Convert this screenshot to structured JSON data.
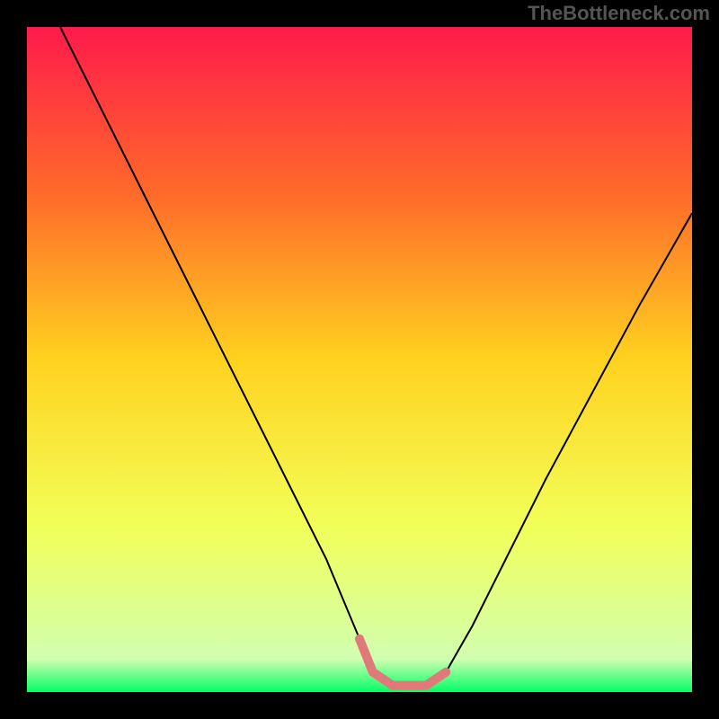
{
  "watermark": "TheBottleneck.com",
  "chart_data": {
    "type": "line",
    "title": "",
    "xlabel": "",
    "ylabel": "",
    "xlim": [
      0,
      100
    ],
    "ylim": [
      0,
      100
    ],
    "gradient_stops": [
      {
        "offset": 0,
        "color": "#ff1a4b"
      },
      {
        "offset": 25,
        "color": "#ff6a2a"
      },
      {
        "offset": 50,
        "color": "#ffd21f"
      },
      {
        "offset": 75,
        "color": "#f2ff59"
      },
      {
        "offset": 95,
        "color": "#d2ffb0"
      },
      {
        "offset": 100,
        "color": "#00ff66"
      }
    ],
    "series": [
      {
        "name": "curve",
        "color": "#000000",
        "x": [
          5,
          10,
          15,
          20,
          25,
          30,
          35,
          40,
          45,
          50,
          52,
          55,
          58,
          60,
          63,
          67,
          72,
          78,
          85,
          92,
          100
        ],
        "y": [
          100,
          90,
          80,
          70,
          60,
          50,
          40,
          30,
          20,
          8,
          3,
          1,
          1,
          1,
          3,
          10,
          20,
          32,
          45,
          58,
          72
        ]
      },
      {
        "name": "flat-highlight",
        "color": "#e07a7a",
        "x": [
          50,
          52,
          55,
          58,
          60,
          63
        ],
        "y": [
          8,
          3,
          1,
          1,
          1,
          3
        ]
      }
    ]
  }
}
